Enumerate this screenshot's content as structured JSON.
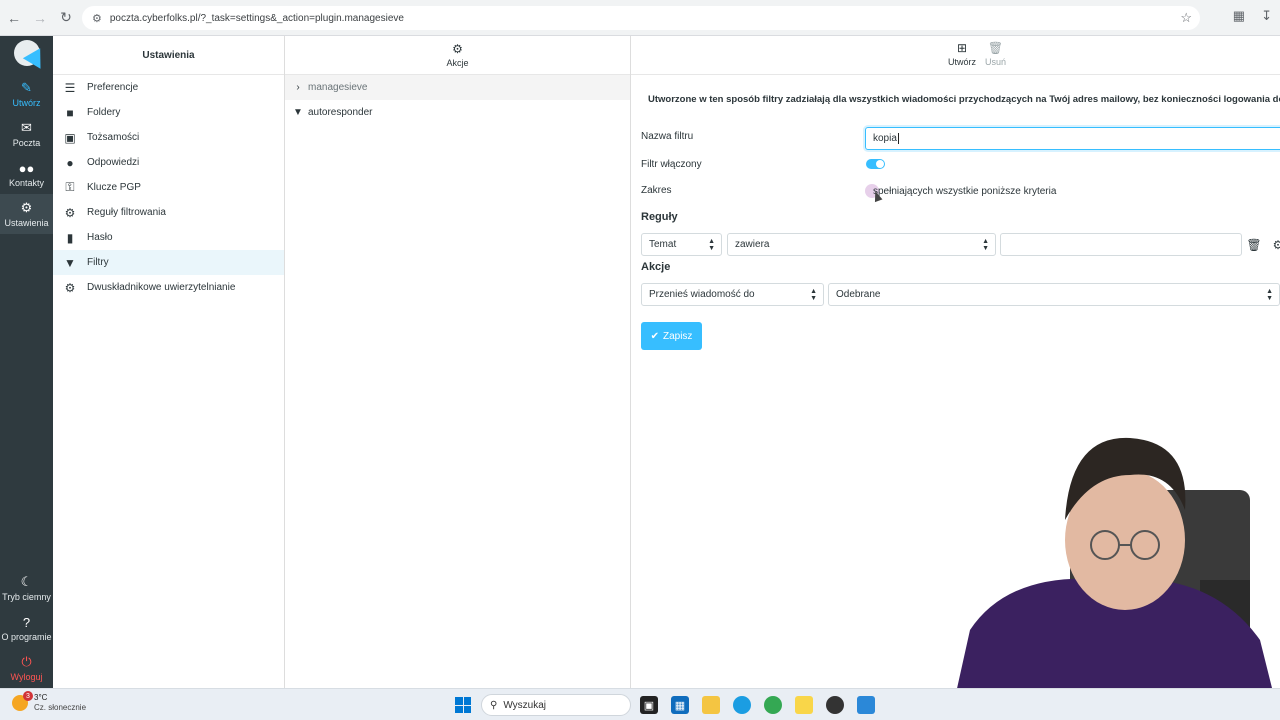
{
  "browser": {
    "url": "poczta.cyberfolks.pl/?_task=settings&_action=plugin.managesieve"
  },
  "rail": {
    "compose": "Utwórz",
    "mail": "Poczta",
    "contacts": "Kontakty",
    "settings": "Ustawienia",
    "dark_mode": "Tryb ciemny",
    "about": "O programie",
    "logout": "Wyloguj"
  },
  "settings_panel": {
    "title": "Ustawienia",
    "items": [
      {
        "label": "Preferencje",
        "icon": "sliders-icon"
      },
      {
        "label": "Foldery",
        "icon": "folder-icon"
      },
      {
        "label": "Tożsamości",
        "icon": "id-card-icon"
      },
      {
        "label": "Odpowiedzi",
        "icon": "comment-icon"
      },
      {
        "label": "Klucze PGP",
        "icon": "key-icon"
      },
      {
        "label": "Reguły filtrowania",
        "icon": "gear-icon"
      },
      {
        "label": "Hasło",
        "icon": "lock-icon"
      },
      {
        "label": "Filtry",
        "icon": "filter-icon"
      },
      {
        "label": "Dwuskładnikowe uwierzytelnianie",
        "icon": "gear-icon"
      }
    ]
  },
  "filters_panel": {
    "actions_label": "Akcje",
    "group": "managesieve",
    "items": [
      "autoresponder"
    ]
  },
  "content": {
    "toolbar": {
      "create": "Utwórz",
      "delete": "Usuń"
    },
    "notice": "Utworzone w ten sposób filtry zadziałają dla wszystkich wiadomości przychodzących na Twój adres mailowy, bez konieczności logowania do webmaila",
    "filter_name_label": "Nazwa filtru",
    "filter_name_value": "kopia",
    "filter_enabled_label": "Filtr włączony",
    "filter_enabled": true,
    "scope_label": "Zakres",
    "scope_value": "spełniających wszystkie poniższe kryteria",
    "rules_title": "Reguły",
    "rule_header": "Temat",
    "rule_op": "zawiera",
    "rule_value": "",
    "actions_title": "Akcje",
    "action_type": "Przenieś wiadomość do",
    "action_target": "Odebrane",
    "save": "Zapisz"
  },
  "taskbar": {
    "temp": "3°C",
    "weather": "Cz. słonecznie",
    "weather_badge": "3",
    "search": "Wyszukaj"
  },
  "colors": {
    "accent": "#37beff",
    "rail_bg": "#2f3a3f",
    "logout": "#ff5552"
  }
}
